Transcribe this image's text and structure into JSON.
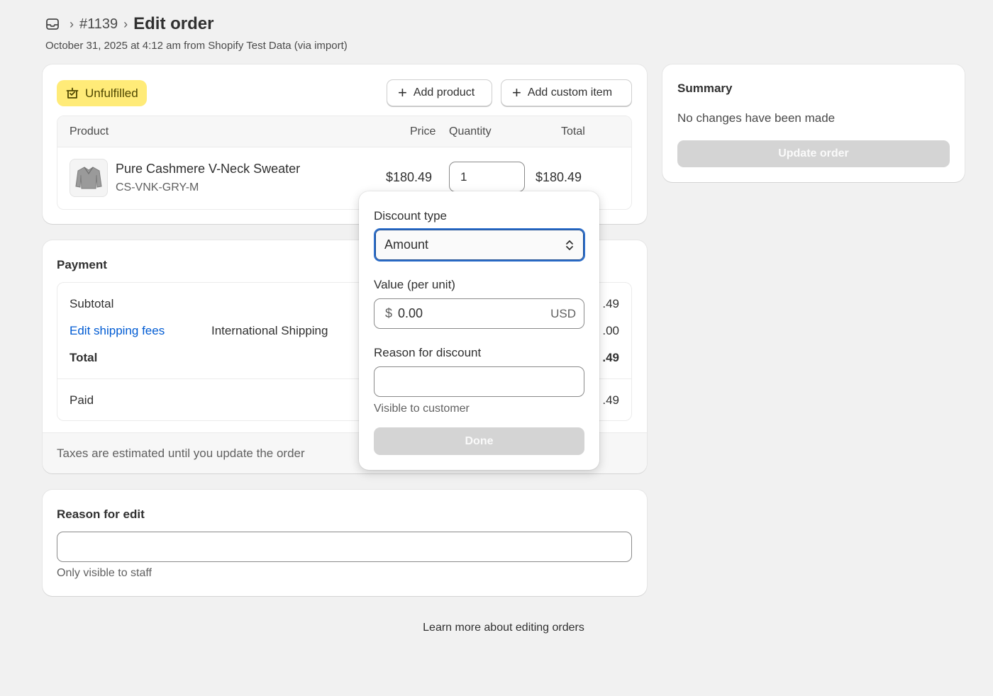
{
  "header": {
    "order_number": "#1139",
    "title": "Edit order",
    "subtitle": "October 31, 2025 at 4:12 am from Shopify Test Data (via import)",
    "separator": "›"
  },
  "fulfillment": {
    "badge_label": "Unfulfilled",
    "add_product_label": "Add product",
    "add_custom_item_label": "Add custom item",
    "columns": {
      "product": "Product",
      "price": "Price",
      "quantity": "Quantity",
      "total": "Total"
    },
    "items": [
      {
        "name": "Pure Cashmere V-Neck Sweater",
        "sku": "CS-VNK-GRY-M",
        "price": "$180.49",
        "quantity": "1",
        "total": "$180.49"
      }
    ]
  },
  "payment": {
    "title": "Payment",
    "subtotal_label": "Subtotal",
    "subtotal_amount": ".49",
    "shipping_link": "Edit shipping fees",
    "shipping_method": "International Shipping",
    "shipping_amount": ".00",
    "total_label": "Total",
    "total_amount": ".49",
    "paid_label": "Paid",
    "paid_amount": ".49",
    "tax_note": "Taxes are estimated until you update the order"
  },
  "reason_for_edit": {
    "title": "Reason for edit",
    "value": "",
    "help": "Only visible to staff"
  },
  "summary": {
    "title": "Summary",
    "text": "No changes have been made",
    "update_button": "Update order"
  },
  "learn_more": "Learn more about editing orders",
  "discount_popover": {
    "type_label": "Discount type",
    "type_value": "Amount",
    "value_label": "Value (per unit)",
    "value_prefix": "$",
    "value": "0.00",
    "value_suffix": "USD",
    "reason_label": "Reason for discount",
    "reason_value": "",
    "reason_help": "Visible to customer",
    "done_button": "Done"
  },
  "colors": {
    "accent_link": "#005bd3",
    "badge_bg": "#ffeb78",
    "focus_ring": "#2c6ecb",
    "disabled_button": "#d4d4d4"
  }
}
